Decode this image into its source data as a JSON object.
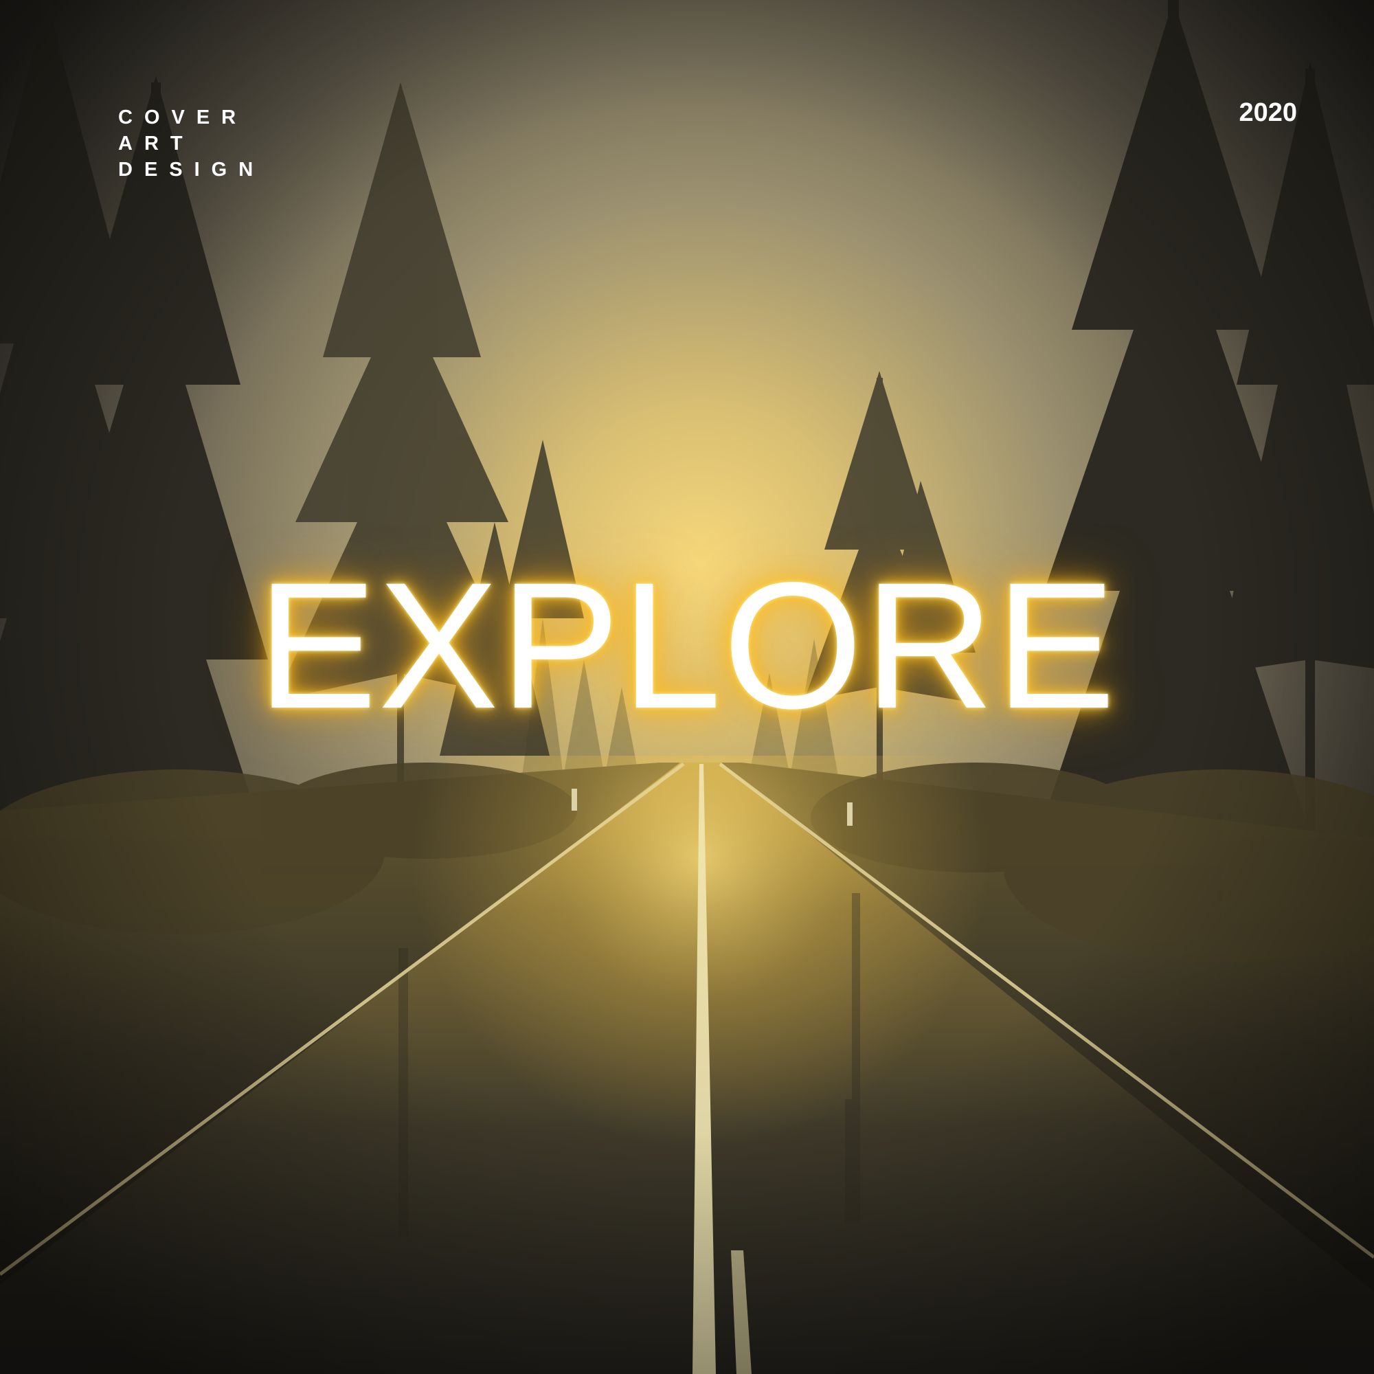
{
  "cover": {
    "label_lines": [
      "COVER",
      "ART",
      "DESIGN"
    ],
    "year": "2020",
    "headline": "EXPLORE"
  },
  "scene": {
    "description_icon": "forest-road-icon",
    "accent_color": "#ffb81c",
    "sky_color": "#8c8468",
    "shadow_color": "#23211c"
  }
}
